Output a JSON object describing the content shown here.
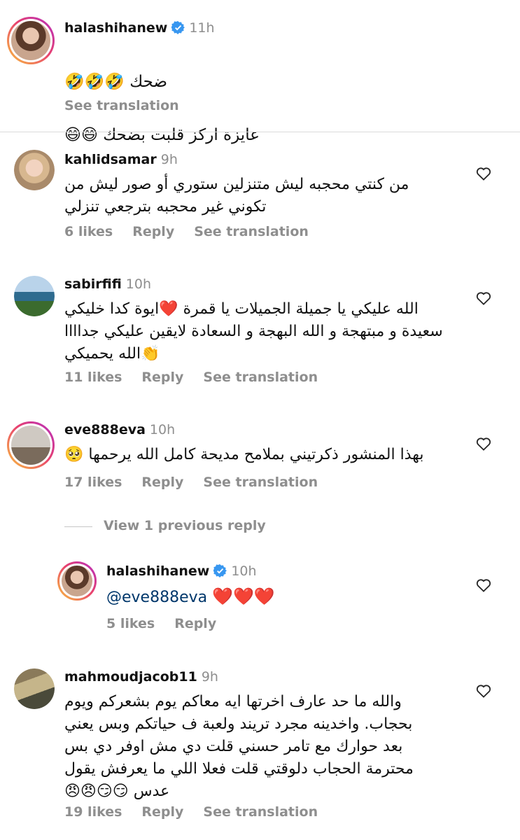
{
  "colors": {
    "username": "#111111",
    "muted": "#8e8e8e",
    "verified": "#3897f0",
    "mention": "#00376b",
    "heart_emoji": "#e0243a"
  },
  "comments": [
    {
      "username": "halashihanew",
      "verified": true,
      "time": "11h",
      "lines": [
        "ضحك 🤣🤣🤣",
        "عايزة اركز قلبت بضحك 😄😄"
      ],
      "see_translation": "See translation"
    },
    {
      "username": "kahlidsamar",
      "time": "9h",
      "text": "من كنتي محجبه ليش متنزلين ستوري أو صور ليش من\nتكوني غير محجبه بترجعي تنزلي",
      "likes": "6 likes",
      "reply": "Reply",
      "see_translation": "See translation"
    },
    {
      "username": "sabirfifi",
      "time": "10h",
      "text": "الله عليكي يا جميلة الجميلات يا قمرة ❤️ايوة كدا خليكي\nسعيدة و مبتهجة و الله البهجة و السعادة لايقين عليكي جداااا\n👏الله يحميكي",
      "likes": "11 likes",
      "reply": "Reply",
      "see_translation": "See translation"
    },
    {
      "username": "eve888eva",
      "time": "10h",
      "text": "بهذا المنشور ذكرتيني بملامح مديحة كامل الله يرحمها 🥺",
      "likes": "17 likes",
      "reply": "Reply",
      "see_translation": "See translation"
    },
    {
      "view_previous": "View 1 previous reply"
    },
    {
      "username": "halashihanew",
      "verified": true,
      "time": "10h",
      "mention": "@eve888eva",
      "hearts": "❤️❤️❤️",
      "likes": "5 likes",
      "reply": "Reply"
    },
    {
      "username": "mahmoudjacob11",
      "time": "9h",
      "text": "والله ما حد عارف اخرتها ايه معاكم يوم بشعركم ويوم\nبحجاب.  واخدينه مجرد تريند  ولعبة ف حياتكم وبس  يعني\nبعد حوارك مع تامر حسني قلت دي مش اوفر دي بس\nمحترمة الحجاب دلوقتي قلت فعلا اللي ما يعرفش يقول\nعدس 😏😏😠😠",
      "likes": "19 likes",
      "reply": "Reply",
      "see_translation": "See translation"
    }
  ]
}
